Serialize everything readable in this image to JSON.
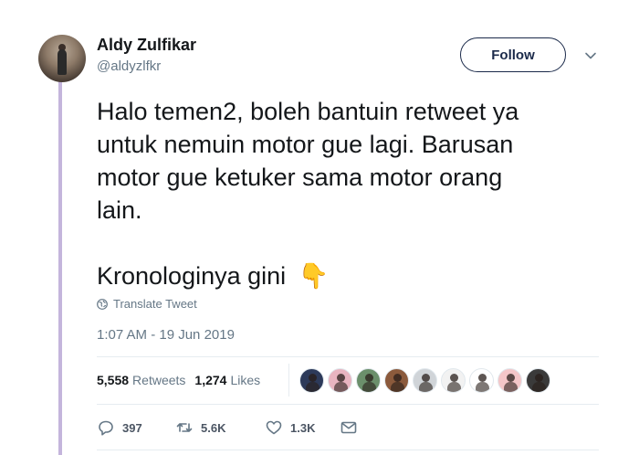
{
  "user": {
    "name": "Aldy Zulfikar",
    "handle": "@aldyzlfkr",
    "follow_label": "Follow"
  },
  "tweet": {
    "lines": [
      "Halo temen2, boleh bantuin retweet ya",
      "untuk nemuin motor gue lagi. Barusan",
      "motor gue ketuker sama motor orang",
      "lain."
    ],
    "last_line": "Kronologinya gini",
    "emoji": "👇",
    "translate_label": "Translate Tweet",
    "timestamp": "1:07 AM - 19 Jun 2019"
  },
  "stats": {
    "retweets_count": "5,558",
    "retweets_label": "Retweets",
    "likes_count": "1,274",
    "likes_label": "Likes"
  },
  "likers": [
    {
      "icon": "avatar",
      "bg": "#2d3a5a"
    },
    {
      "icon": "avatar",
      "bg": "#e8b4c0"
    },
    {
      "icon": "avatar",
      "bg": "#6b8f6b"
    },
    {
      "icon": "avatar",
      "bg": "#8b5a3c"
    },
    {
      "icon": "avatar",
      "bg": "#d0d4d8"
    },
    {
      "icon": "avatar",
      "bg": "#f2f2f2"
    },
    {
      "icon": "avatar",
      "bg": "#ffffff"
    },
    {
      "icon": "avatar",
      "bg": "#f4c6c8"
    },
    {
      "icon": "avatar",
      "bg": "#3a3a3a"
    }
  ],
  "actions": {
    "replies": "397",
    "retweets": "5.6K",
    "likes": "1.3K"
  }
}
